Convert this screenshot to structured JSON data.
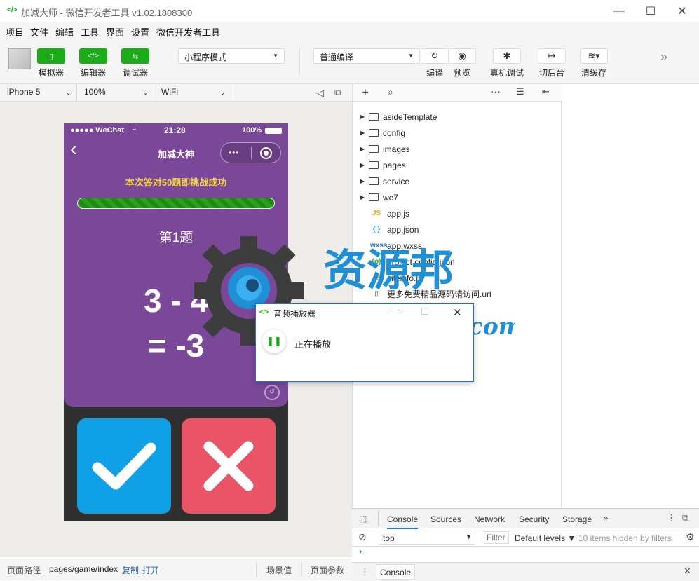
{
  "titlebar": {
    "icon": "</>",
    "title": "加减大师 - 微信开发者工具 v1.02.1808300",
    "min": "—",
    "max": "☐",
    "close": "✕"
  },
  "menubar": {
    "items": [
      "项目",
      "文件",
      "编辑",
      "工具",
      "界面",
      "设置",
      "微信开发者工具"
    ]
  },
  "toolbar": {
    "sim_label": "模拟器",
    "editor_label": "编辑器",
    "debug_label": "调试器",
    "mode": "小程序模式",
    "compile_mode": "普通编译",
    "compile_label": "编译",
    "preview_label": "预览",
    "remote_label": "真机调试",
    "background_label": "切后台",
    "cache_label": "清缓存",
    "more": "»"
  },
  "devbar": {
    "device": "iPhone 5",
    "zoom": "100%",
    "network": "WiFi"
  },
  "phone": {
    "status_left": "●●●●● WeChat",
    "time": "21:28",
    "battery": "100%",
    "nav_title": "加减大神",
    "back": "‹",
    "menu_dots": "•••",
    "banner": "本次答对50题即挑战成功",
    "progress": 1.0,
    "question_no": "第1题",
    "expr": "3 - 4",
    "result": "= -3"
  },
  "filetree": {
    "folders": [
      "asideTemplate",
      "config",
      "images",
      "pages",
      "service",
      "we7"
    ],
    "files": [
      {
        "icon": "JS",
        "name": "app.js",
        "color": "#e6a817"
      },
      {
        "icon": "{ }",
        "name": "app.json",
        "color": "#1f8ad6"
      },
      {
        "icon": "wxss",
        "name": "app.wxss",
        "color": "#2b6fb3"
      },
      {
        "icon": "{o}",
        "name": "project.config.json",
        "color": "#1aad19"
      },
      {
        "icon": "JS",
        "name": "siteinfo.js",
        "color": "#e6a817"
      },
      {
        "icon": "▯",
        "name": "更多免费精品源码请访问.url",
        "color": "#444"
      }
    ]
  },
  "console": {
    "tabs": [
      "Console",
      "Sources",
      "Network",
      "Security",
      "Storage"
    ],
    "context": "top",
    "filter_placeholder": "Filter",
    "levels": "Default levels ▼",
    "hidden": "10 items hidden by filters",
    "prompt": "›",
    "drawer_tab": "Console"
  },
  "statusbar": {
    "path_label": "页面路径",
    "path": "pages/game/index",
    "copy": "复制",
    "open": "打开",
    "scene": "场景值",
    "params": "页面参数"
  },
  "dialog": {
    "title": "音频播放器",
    "status": "正在播放"
  },
  "watermark": {
    "text": "资源邦",
    "url": "www.wazyb.com"
  }
}
